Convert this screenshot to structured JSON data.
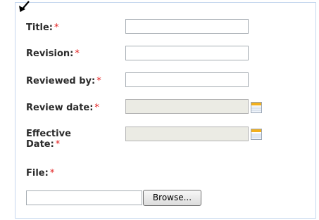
{
  "form": {
    "title_label": "Title:",
    "revision_label": "Revision:",
    "reviewed_by_label": "Reviewed by:",
    "review_date_label": "Review date:",
    "effective_date_label_line1": "Effective",
    "effective_date_label_line2": "Date:",
    "file_label": "File:",
    "required_marker": "*",
    "title_value": "",
    "revision_value": "",
    "reviewed_by_value": "",
    "review_date_value": "",
    "effective_date_value": "",
    "file_value": "",
    "browse_label": "Browse..."
  },
  "icons": {
    "calendar": "calendar-icon",
    "cursor": "mouse-pointer-icon"
  },
  "colors": {
    "required": "#e31c1c",
    "panel_border": "#c5d7ee",
    "disabled_field": "#ebebe4",
    "calendar_accent": "#f2b01e"
  }
}
